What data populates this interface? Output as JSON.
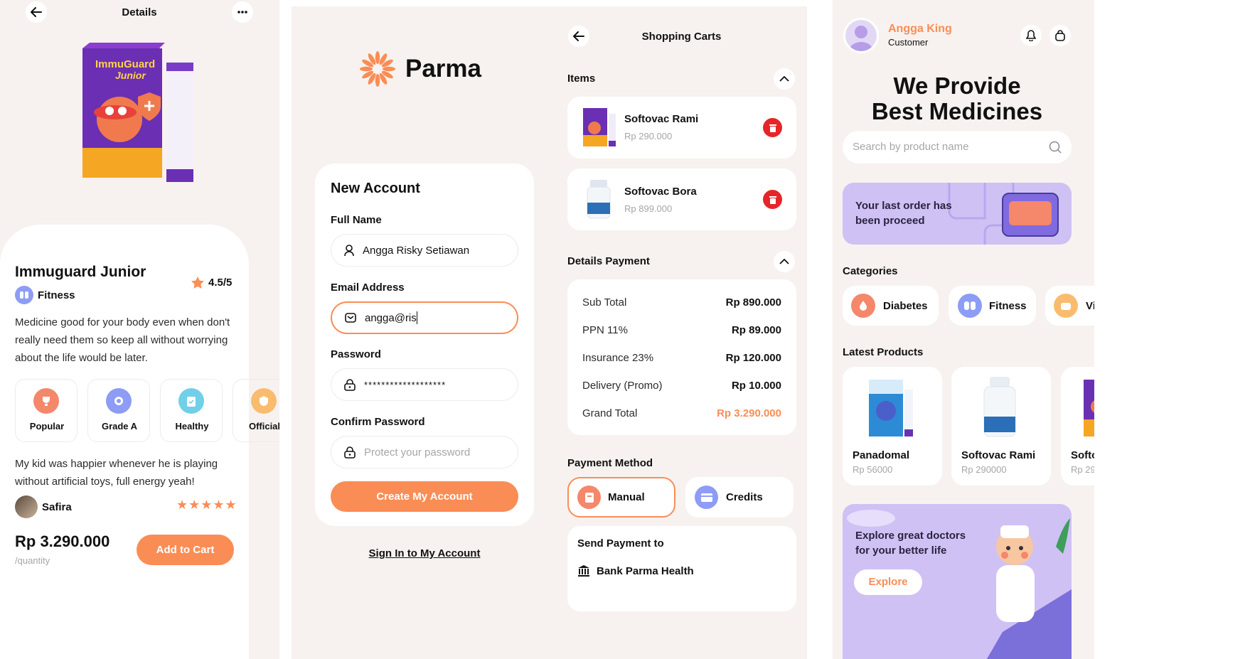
{
  "colors": {
    "accent": "#fa8d55",
    "bg_warm": "#f7f2ef",
    "purple_light": "#cfc1f4",
    "danger": "#e5252a"
  },
  "details": {
    "header_title": "Details",
    "product_name": "Immuguard Junior",
    "category": "Fitness",
    "rating": "4.5/5",
    "description": "Medicine good for your body even when don't really need them so keep all without worrying about the life would be later.",
    "features": [
      "Popular",
      "Grade A",
      "Healthy",
      "Official"
    ],
    "review_text": "My kid was happier whenever he is playing without artificial toys, full energy yeah!",
    "reviewer": "Safira",
    "stars": "★★★★★",
    "price": "Rp 3.290.000",
    "price_unit": "/quantity",
    "add_to_cart": "Add to Cart",
    "box_brand": "ImmuGuard",
    "box_sub": "Junior"
  },
  "signup": {
    "brand": "Parma",
    "title": "New Account",
    "full_name_label": "Full Name",
    "full_name_value": "Angga Risky Setiawan",
    "email_label": "Email Address",
    "email_value": "angga@ris",
    "password_label": "Password",
    "password_value": "*******************",
    "confirm_label": "Confirm Password",
    "confirm_placeholder": "Protect your password",
    "create_button": "Create My Account",
    "sign_in_link": "Sign In to My Account"
  },
  "cart": {
    "title": "Shopping Carts",
    "items_label": "Items",
    "items": [
      {
        "name": "Softovac Rami",
        "price": "Rp 290.000"
      },
      {
        "name": "Softovac Bora",
        "price": "Rp 899.000"
      }
    ],
    "details_label": "Details Payment",
    "payment_rows": [
      {
        "label": "Sub Total",
        "value": "Rp 890.000"
      },
      {
        "label": "PPN 11%",
        "value": "Rp 89.000"
      },
      {
        "label": "Insurance 23%",
        "value": "Rp 120.000"
      },
      {
        "label": "Delivery (Promo)",
        "value": "Rp 10.000"
      }
    ],
    "grand_total_label": "Grand Total",
    "grand_total_value": "Rp 3.290.000",
    "method_label": "Payment Method",
    "methods": [
      "Manual",
      "Credits"
    ],
    "send_label": "Send Payment to",
    "bank": "Bank Parma Health"
  },
  "home": {
    "user_name": "Angga King",
    "user_role": "Customer",
    "headline_1": "We Provide",
    "headline_2": "Best Medicines",
    "search_placeholder": "Search by product name",
    "order_banner": "Your last order has been proceed",
    "categories_label": "Categories",
    "categories": [
      "Diabetes",
      "Fitness",
      "Vi"
    ],
    "latest_label": "Latest Products",
    "products": [
      {
        "name": "Panadomal",
        "price": "Rp 56000"
      },
      {
        "name": "Softovac Rami",
        "price": "Rp 290000"
      },
      {
        "name": "Softo",
        "price": "Rp 29"
      }
    ],
    "doctor_banner": "Explore great doctors for your better life",
    "explore_button": "Explore"
  }
}
